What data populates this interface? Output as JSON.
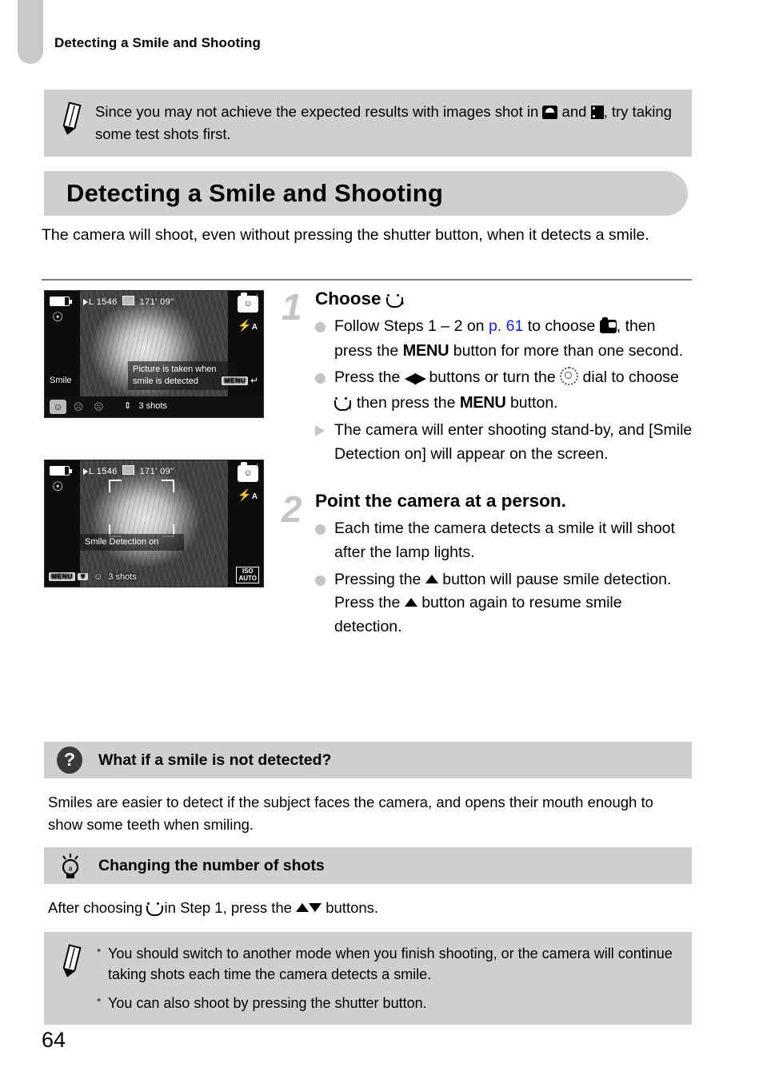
{
  "page": {
    "running_head": "Detecting a Smile and Shooting",
    "number": "64"
  },
  "top_note": {
    "icon": "pencil-icon",
    "text_before_icon1": "Since you may not achieve the expected results with images shot in ",
    "text_between": " and ",
    "text_after": ", try taking some test shots first.",
    "icon1": "scene-portrait-icon",
    "icon2": "movie-mode-icon"
  },
  "section": {
    "title": "Detecting a Smile and Shooting",
    "intro": "The camera will shoot, even without pressing the shutter button, when it detects a smile."
  },
  "lcd_screens": [
    {
      "name": "smile-setting-screen",
      "battery": "battery-full-icon",
      "mode_icon": "portrait-mode-icon",
      "quality": "L",
      "shots_remaining": "1546",
      "card": "memory-card-icon",
      "rec_time": "171' 09\"",
      "shutter_icon": "smile-shutter-icon",
      "flash": "flash-auto-icon",
      "message": "Picture is taken when\nsmile is detected",
      "label": "Smile",
      "menu_chip": "MENU",
      "menu_back": "↵",
      "options": [
        "smile-face-icon",
        "wink-self-timer-icon",
        "face-self-timer-icon"
      ],
      "selected_option": 0,
      "shots_label": "3 shots",
      "stepper": "up-down-arrows-icon"
    },
    {
      "name": "smile-detection-on-screen",
      "battery": "battery-full-icon",
      "mode_icon": "portrait-mode-icon",
      "quality": "L",
      "shots_remaining": "1546",
      "card": "memory-card-icon",
      "rec_time": "171' 09\"",
      "shutter_icon": "smile-shutter-icon",
      "flash": "flash-auto-icon",
      "message": "Smile Detection on",
      "menu_chip": "MENU",
      "down_arrow": "down-arrow-icon",
      "face_icon": "smile-face-icon",
      "shots_label": "3 shots",
      "iso": "ISO\nAUTO"
    }
  ],
  "steps": [
    {
      "number": "1",
      "title_before": "Choose",
      "title_icon": "smile-face-icon",
      "title_after": ".",
      "items": [
        {
          "bullet": "dot",
          "parts": [
            {
              "t": "text",
              "v": "Follow Steps 1 – 2 on "
            },
            {
              "t": "link",
              "v": "p. 61"
            },
            {
              "t": "text",
              "v": " to choose "
            },
            {
              "t": "icon",
              "v": "smile-shutter-icon"
            },
            {
              "t": "text",
              "v": ", then press the "
            },
            {
              "t": "bold",
              "v": "MENU"
            },
            {
              "t": "text",
              "v": " button for more than one second."
            }
          ]
        },
        {
          "bullet": "dot",
          "parts": [
            {
              "t": "text",
              "v": "Press the "
            },
            {
              "t": "icon",
              "v": "left-right-buttons-icon"
            },
            {
              "t": "text",
              "v": " buttons or turn the "
            },
            {
              "t": "icon",
              "v": "control-dial-icon"
            },
            {
              "t": "text",
              "v": " dial to choose "
            },
            {
              "t": "icon",
              "v": "smile-face-icon"
            },
            {
              "t": "text",
              "v": ", then press the "
            },
            {
              "t": "bold",
              "v": "MENU"
            },
            {
              "t": "text",
              "v": " button."
            }
          ]
        },
        {
          "bullet": "triangle",
          "parts": [
            {
              "t": "text",
              "v": "The camera will enter shooting stand-by, and [Smile Detection on] will appear on the screen."
            }
          ]
        }
      ]
    },
    {
      "number": "2",
      "title_before": "Point the camera at a person.",
      "title_icon": "",
      "title_after": "",
      "items": [
        {
          "bullet": "dot",
          "parts": [
            {
              "t": "text",
              "v": "Each time the camera detects a smile it will shoot after the lamp lights."
            }
          ]
        },
        {
          "bullet": "dot",
          "parts": [
            {
              "t": "text",
              "v": "Pressing the "
            },
            {
              "t": "icon",
              "v": "up-button-icon"
            },
            {
              "t": "text",
              "v": " button will pause smile detection. Press the "
            },
            {
              "t": "icon",
              "v": "up-button-icon"
            },
            {
              "t": "text",
              "v": " button again to resume smile detection."
            }
          ]
        }
      ]
    }
  ],
  "qa": {
    "icon": "question-mark-icon",
    "title": "What if a smile is not detected?",
    "body": "Smiles are easier to detect if the subject faces the camera, and opens their mouth enough to show some teeth when smiling."
  },
  "tip": {
    "icon": "lightbulb-icon",
    "title": "Changing the number of shots",
    "body_before": "After choosing ",
    "body_icon": "smile-face-icon",
    "body_mid": " in Step 1, press the ",
    "body_icon2": "up-down-buttons-icon",
    "body_after": " buttons."
  },
  "bottom_note": {
    "icon": "pencil-icon",
    "bullets": [
      "You should switch to another mode when you finish shooting, or the camera will continue taking shots each time the camera detects a smile.",
      "You can also shoot by pressing the shutter button."
    ]
  },
  "colors": {
    "box_grey": "#cfcfcf",
    "tab_grey": "#c9c9c9",
    "link_blue": "#1423e8",
    "step_number_grey": "#c4c4c4"
  }
}
